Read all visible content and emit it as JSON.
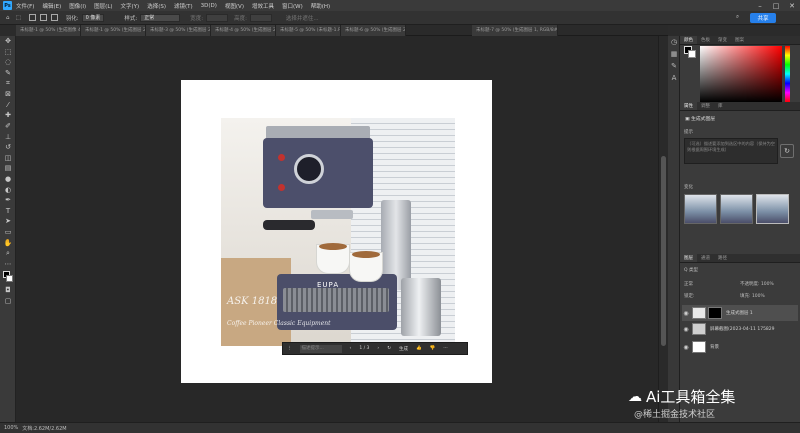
{
  "app": {
    "logo": "Ps"
  },
  "menu": [
    "文件(F)",
    "编辑(E)",
    "图像(I)",
    "图层(L)",
    "文字(Y)",
    "选择(S)",
    "滤镜(T)",
    "3D(D)",
    "视图(V)",
    "增效工具",
    "窗口(W)",
    "帮助(H)"
  ],
  "options": {
    "feather_label": "羽化:",
    "feather_value": "0 像素",
    "style_label": "样式:",
    "style_value": "正常",
    "width_label": "宽度:",
    "height_label": "高度:",
    "select_mask": "选择并遮住..."
  },
  "share_label": "共享",
  "tabs": [
    "未标题-1 @ 50% (生成图像 4...",
    "未标题-1 @ 50% (生成图层 2...",
    "未标题-3 @ 50% (生成图层 2...",
    "未标题-4 @ 50% (生成图层 2...",
    "未标题-5 @ 50% (未标题-1.RGB)...",
    "未标题-6 @ 50% (生成图层 2...",
    "未标题-7 @ 50% (生成图层 1, RGB/8#)"
  ],
  "photo_text": {
    "line1": "ASK 1818",
    "line2": "Coffee Pioneer Classic Equipment",
    "brand": "EUPA"
  },
  "gen_bar": {
    "placeholder": "描述提示...",
    "counter": "1 / 3",
    "generate": "生成"
  },
  "panels": {
    "color_tabs": [
      "颜色",
      "色板",
      "渐变",
      "图案"
    ],
    "props_tabs": [
      "属性",
      "调整",
      "库"
    ],
    "gen_layer_label": "生成式图层",
    "prompt_label": "提示",
    "prompt_text": "（可选）描述要添加到选区中的内容（保持为空则根据周围环境生成）",
    "variations_label": "变化",
    "layers_tabs": [
      "图层",
      "通道",
      "路径"
    ],
    "kind_label": "Q 类型",
    "mode_label": "正常",
    "opacity_label": "不透明度: 100%",
    "fill_label": "填充: 100%",
    "lock_label": "锁定:",
    "layers": [
      {
        "name": "生成式图层 1",
        "selected": true
      },
      {
        "name": "屏幕截图(2023-04-11 175829",
        "selected": false
      },
      {
        "name": "背景",
        "selected": false
      }
    ]
  },
  "status": {
    "zoom": "100%",
    "doc": "文档:2.62M/2.62M"
  },
  "watermark": {
    "title": "Ai工具箱全集",
    "subtitle": "@稀土掘金技术社区"
  }
}
